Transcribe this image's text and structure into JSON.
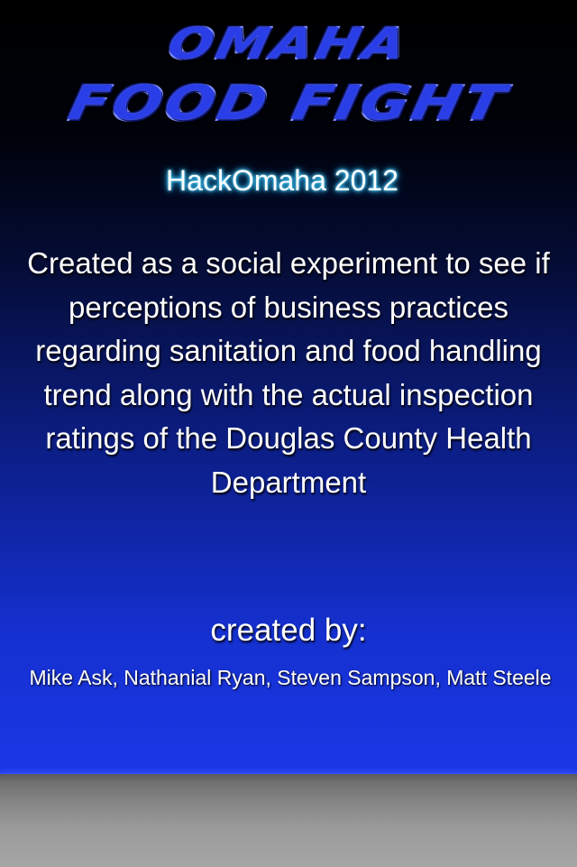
{
  "logo": {
    "line1": "OMAHA",
    "line2": "FOOD FIGHT"
  },
  "subtitle": "HackOmaha 2012",
  "description": "Created as a social experiment to see if perceptions of business practices regarding sanitation and food handling trend along with the actual inspection ratings of the Douglas County Health Department",
  "credits": {
    "label": "created by:",
    "authors": "Mike Ask, Nathanial Ryan, Steven Sampson, Matt Steele"
  },
  "colors": {
    "accent_blue": "#1a38e6",
    "glow_cyan": "#3ad0ff",
    "footer_gray": "#9a9a9a"
  }
}
